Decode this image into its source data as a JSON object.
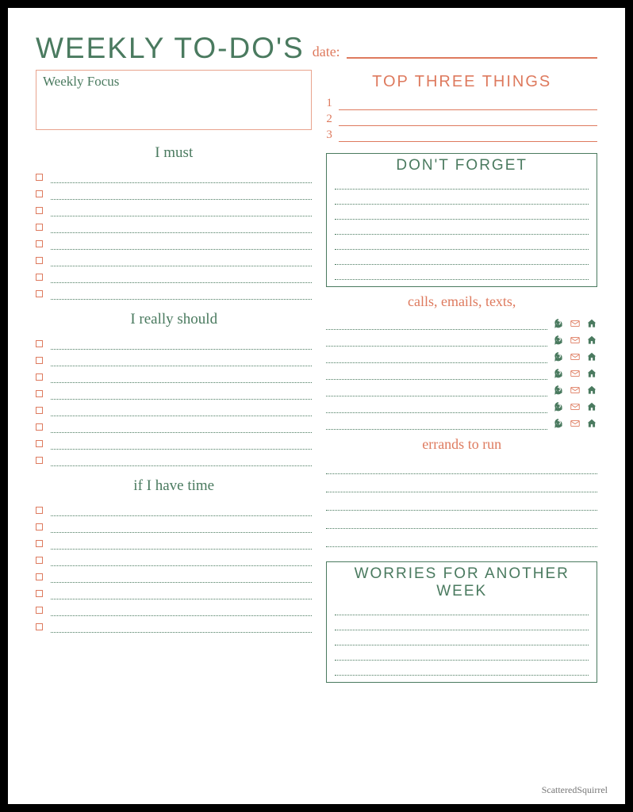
{
  "title": "WEEKLY TO-DO'S",
  "date_label": "date:",
  "focus_label": "Weekly Focus",
  "sections": {
    "must": "I must",
    "should": "I really should",
    "iftime": "if I have time"
  },
  "top_three": {
    "heading": "TOP THREE THINGS",
    "numbers": [
      "1",
      "2",
      "3"
    ]
  },
  "dont_forget": "DON'T FORGET",
  "contacts_heading": "calls, emails, texts,",
  "errands_heading": "errands to run",
  "worries_heading": "WORRIES FOR ANOTHER WEEK",
  "icons": {
    "phone": "phone-icon",
    "mail": "mail-icon",
    "home": "home-icon"
  },
  "counts": {
    "must_lines": 8,
    "should_lines": 8,
    "iftime_lines": 8,
    "dont_forget_lines": 7,
    "contact_rows": 7,
    "errand_lines": 5,
    "worries_lines": 5
  },
  "watermark": "ScatteredSquirrel"
}
